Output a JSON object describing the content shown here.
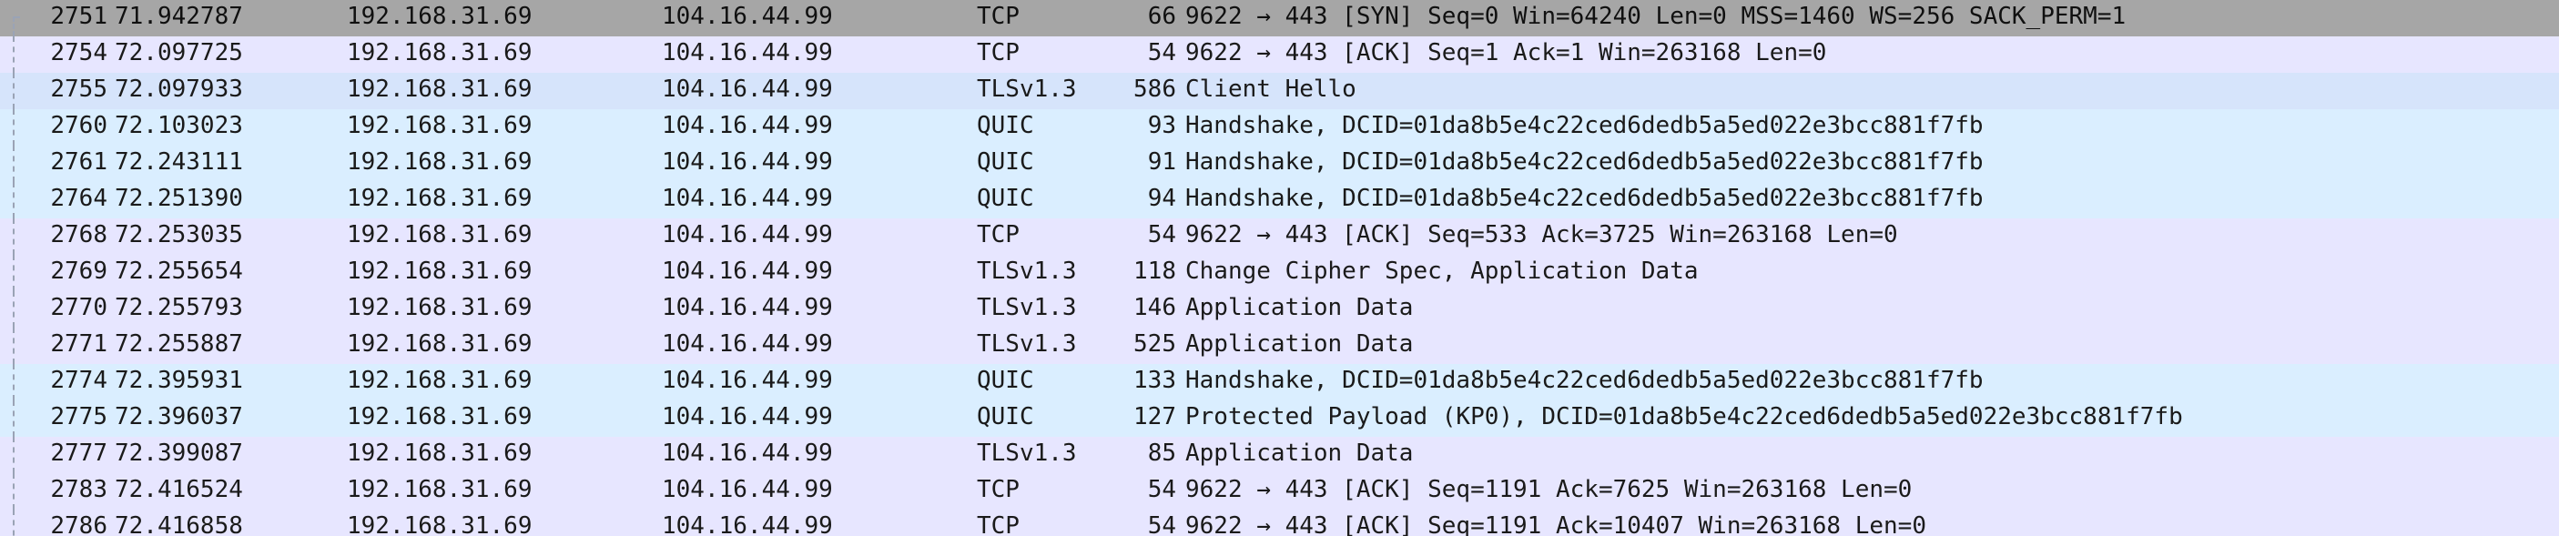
{
  "packets": [
    {
      "no": "2751",
      "time": "71.942787",
      "src": "192.168.31.69",
      "dst": "104.16.44.99",
      "proto": "TCP",
      "len": "66",
      "info": "9622 → 443 [SYN] Seq=0 Win=64240 Len=0 MSS=1460 WS=256 SACK_PERM=1"
    },
    {
      "no": "2754",
      "time": "72.097725",
      "src": "192.168.31.69",
      "dst": "104.16.44.99",
      "proto": "TCP",
      "len": "54",
      "info": "9622 → 443 [ACK] Seq=1 Ack=1 Win=263168 Len=0"
    },
    {
      "no": "2755",
      "time": "72.097933",
      "src": "192.168.31.69",
      "dst": "104.16.44.99",
      "proto": "TLSv1.3",
      "len": "586",
      "info": "Client Hello"
    },
    {
      "no": "2760",
      "time": "72.103023",
      "src": "192.168.31.69",
      "dst": "104.16.44.99",
      "proto": "QUIC",
      "len": "93",
      "info": "Handshake, DCID=01da8b5e4c22ced6dedb5a5ed022e3bcc881f7fb"
    },
    {
      "no": "2761",
      "time": "72.243111",
      "src": "192.168.31.69",
      "dst": "104.16.44.99",
      "proto": "QUIC",
      "len": "91",
      "info": "Handshake, DCID=01da8b5e4c22ced6dedb5a5ed022e3bcc881f7fb"
    },
    {
      "no": "2764",
      "time": "72.251390",
      "src": "192.168.31.69",
      "dst": "104.16.44.99",
      "proto": "QUIC",
      "len": "94",
      "info": "Handshake, DCID=01da8b5e4c22ced6dedb5a5ed022e3bcc881f7fb"
    },
    {
      "no": "2768",
      "time": "72.253035",
      "src": "192.168.31.69",
      "dst": "104.16.44.99",
      "proto": "TCP",
      "len": "54",
      "info": "9622 → 443 [ACK] Seq=533 Ack=3725 Win=263168 Len=0"
    },
    {
      "no": "2769",
      "time": "72.255654",
      "src": "192.168.31.69",
      "dst": "104.16.44.99",
      "proto": "TLSv1.3",
      "len": "118",
      "info": "Change Cipher Spec, Application Data"
    },
    {
      "no": "2770",
      "time": "72.255793",
      "src": "192.168.31.69",
      "dst": "104.16.44.99",
      "proto": "TLSv1.3",
      "len": "146",
      "info": "Application Data"
    },
    {
      "no": "2771",
      "time": "72.255887",
      "src": "192.168.31.69",
      "dst": "104.16.44.99",
      "proto": "TLSv1.3",
      "len": "525",
      "info": "Application Data"
    },
    {
      "no": "2774",
      "time": "72.395931",
      "src": "192.168.31.69",
      "dst": "104.16.44.99",
      "proto": "QUIC",
      "len": "133",
      "info": "Handshake, DCID=01da8b5e4c22ced6dedb5a5ed022e3bcc881f7fb"
    },
    {
      "no": "2775",
      "time": "72.396037",
      "src": "192.168.31.69",
      "dst": "104.16.44.99",
      "proto": "QUIC",
      "len": "127",
      "info": "Protected Payload (KP0), DCID=01da8b5e4c22ced6dedb5a5ed022e3bcc881f7fb"
    },
    {
      "no": "2777",
      "time": "72.399087",
      "src": "192.168.31.69",
      "dst": "104.16.44.99",
      "proto": "TLSv1.3",
      "len": "85",
      "info": "Application Data"
    },
    {
      "no": "2783",
      "time": "72.416524",
      "src": "192.168.31.69",
      "dst": "104.16.44.99",
      "proto": "TCP",
      "len": "54",
      "info": "9622 → 443 [ACK] Seq=1191 Ack=7625 Win=263168 Len=0"
    },
    {
      "no": "2786",
      "time": "72.416858",
      "src": "192.168.31.69",
      "dst": "104.16.44.99",
      "proto": "TCP",
      "len": "54",
      "info": "9622 → 443 [ACK] Seq=1191 Ack=10407 Win=263168 Len=0"
    }
  ],
  "colors": {
    "tcp_row": "#e7e6ff",
    "quic_row": "#daeeff",
    "client_hello_row": "#d6e4fb",
    "selected_row": "#a6a6a6"
  }
}
